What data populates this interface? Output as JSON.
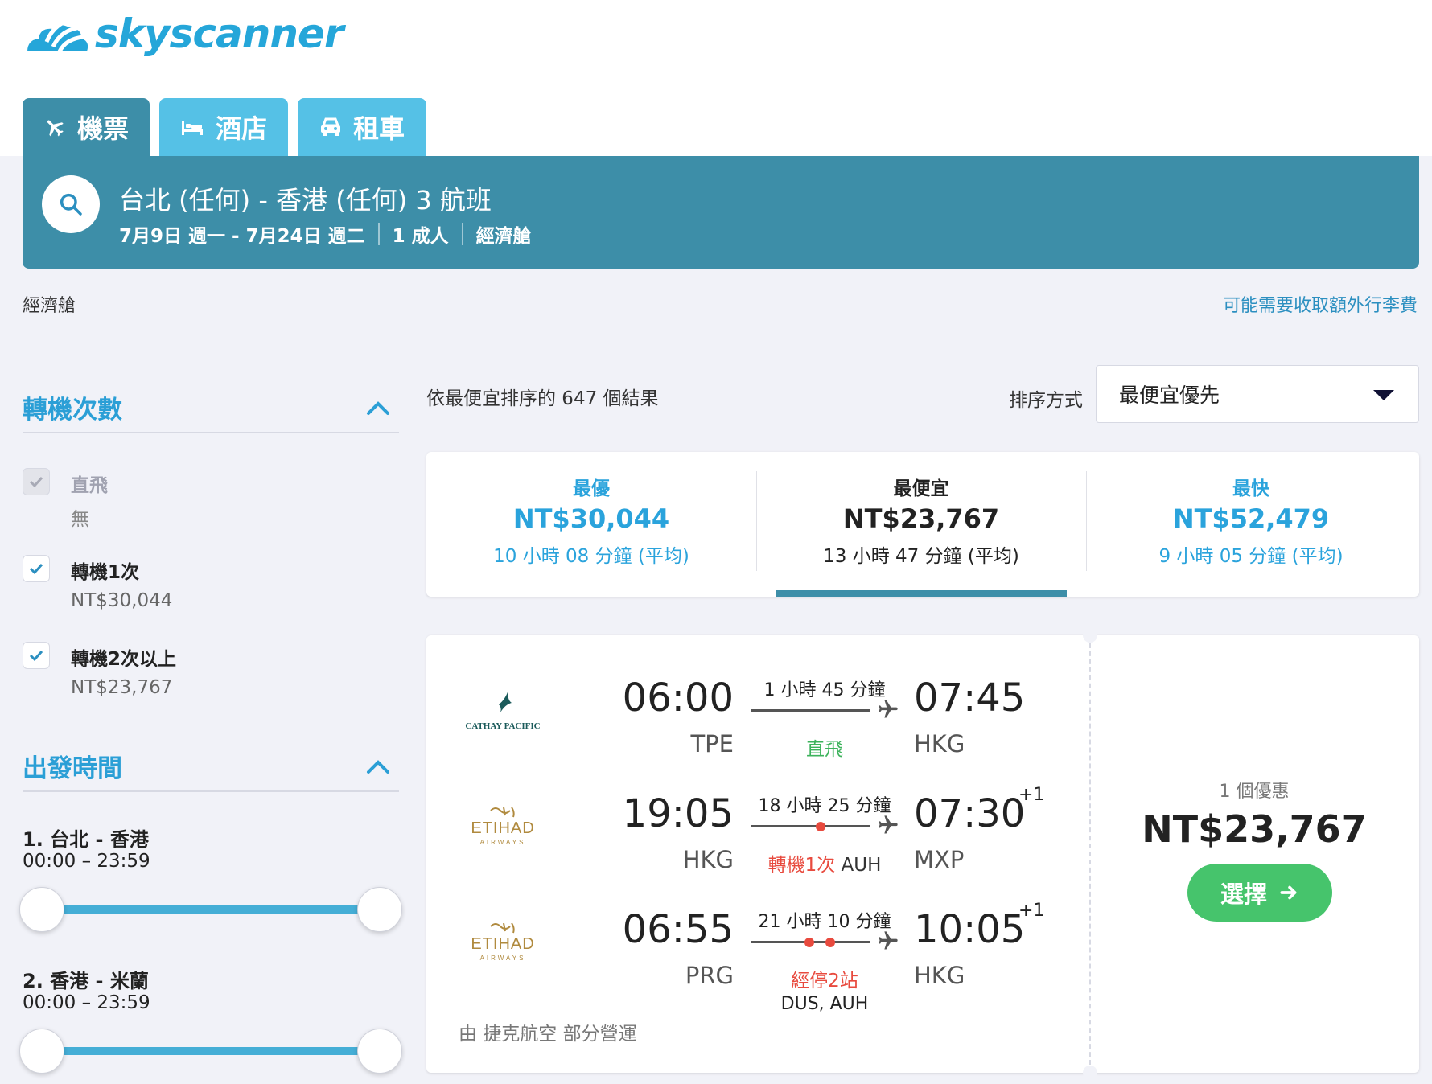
{
  "brand": {
    "name": "skyscanner"
  },
  "tabs": [
    {
      "label": "機票",
      "icon": "plane-icon",
      "active": true
    },
    {
      "label": "酒店",
      "icon": "bed-icon",
      "active": false
    },
    {
      "label": "租車",
      "icon": "car-icon",
      "active": false
    }
  ],
  "search": {
    "title": "台北 (任何) - 香港 (任何) 3 航班",
    "dates": "7月9日 週一 - 7月24日 週二",
    "travelers": "1 成人",
    "cabin": "經濟艙"
  },
  "cabin_label": "經濟艙",
  "baggage_link": "可能需要收取額外行李費",
  "filters": {
    "stops": {
      "heading": "轉機次數",
      "options": [
        {
          "label": "直飛",
          "sub": "無",
          "checked": true,
          "disabled": true
        },
        {
          "label": "轉機1次",
          "sub": "NT$30,044",
          "checked": true,
          "disabled": false
        },
        {
          "label": "轉機2次以上",
          "sub": "NT$23,767",
          "checked": true,
          "disabled": false
        }
      ]
    },
    "departure": {
      "heading": "出發時間",
      "routes": [
        {
          "label": "1. 台北 - 香港",
          "range": "00:00 – 23:59"
        },
        {
          "label": "2. 香港 - 米蘭",
          "range": "00:00 – 23:59"
        }
      ]
    }
  },
  "results": {
    "count_text": "依最便宜排序的 647 個結果",
    "sort_label": "排序方式",
    "sort_value": "最便宜優先"
  },
  "sort_tabs": [
    {
      "label": "最優",
      "price": "NT$30,044",
      "duration": "10 小時 08 分鐘 (平均)"
    },
    {
      "label": "最便宜",
      "price": "NT$23,767",
      "duration": "13 小時 47 分鐘 (平均)"
    },
    {
      "label": "最快",
      "price": "NT$52,479",
      "duration": "9 小時 05 分鐘 (平均)"
    }
  ],
  "itinerary": {
    "legs": [
      {
        "airline": "CATHAY PACIFIC",
        "dep_time": "06:00",
        "dep_code": "TPE",
        "arr_time": "07:45",
        "arr_code": "HKG",
        "plus": "",
        "duration": "1 小時 45 分鐘",
        "stops": "直飛",
        "via": ""
      },
      {
        "airline": "ETIHAD AIRWAYS",
        "dep_time": "19:05",
        "dep_code": "HKG",
        "arr_time": "07:30",
        "arr_code": "MXP",
        "plus": "+1",
        "duration": "18 小時 25 分鐘",
        "stops": "轉機1次",
        "stop_airport": "AUH",
        "via": ""
      },
      {
        "airline": "ETIHAD AIRWAYS",
        "dep_time": "06:55",
        "dep_code": "PRG",
        "arr_time": "10:05",
        "arr_code": "HKG",
        "plus": "+1",
        "duration": "21 小時 10 分鐘",
        "stops": "經停2站",
        "via": "DUS, AUH"
      }
    ],
    "operated_by": "由 捷克航空 部分營運",
    "deal_count": "1 個優惠",
    "price": "NT$23,767",
    "select_label": "選擇"
  },
  "colors": {
    "tab_active": "#3d8ea8",
    "tab_inactive": "#55c1e6",
    "accent_blue": "#2aa3dc",
    "select_green": "#46c46c",
    "stop_red": "#e84a3e",
    "direct_green": "#3db35c"
  }
}
